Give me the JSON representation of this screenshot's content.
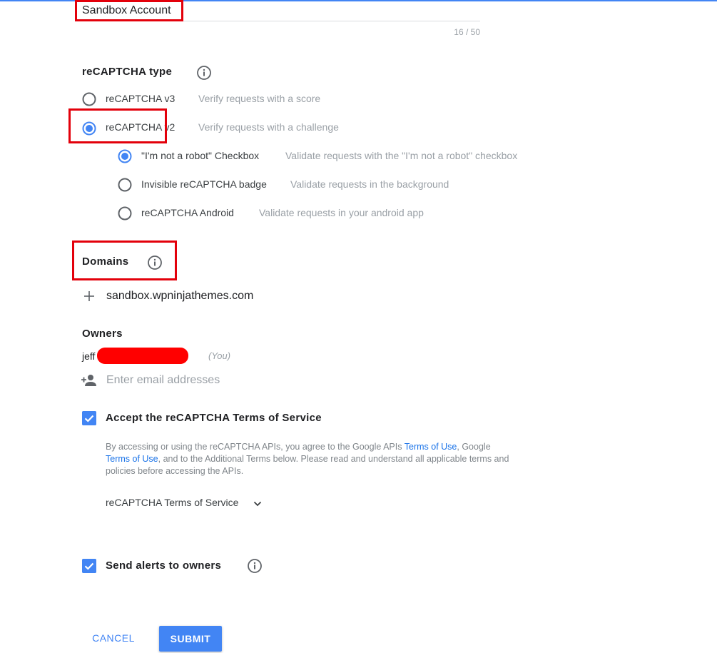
{
  "label_field": {
    "value": "Sandbox Account",
    "counter": "16 / 50"
  },
  "recaptcha_type": {
    "title": "reCAPTCHA type",
    "options": [
      {
        "label": "reCAPTCHA v3",
        "description": "Verify requests with a score",
        "selected": false
      },
      {
        "label": "reCAPTCHA v2",
        "description": "Verify requests with a challenge",
        "selected": true
      }
    ],
    "v2_options": [
      {
        "label": "\"I'm not a robot\" Checkbox",
        "description": "Validate requests with the \"I'm not a robot\" checkbox",
        "selected": true
      },
      {
        "label": "Invisible reCAPTCHA badge",
        "description": "Validate requests in the background",
        "selected": false
      },
      {
        "label": "reCAPTCHA Android",
        "description": "Validate requests in your android app",
        "selected": false
      }
    ]
  },
  "domains": {
    "title": "Domains",
    "items": [
      "sandbox.wpninjathemes.com"
    ]
  },
  "owners": {
    "title": "Owners",
    "items": [
      {
        "name": "jeff",
        "tag": "(You)"
      }
    ],
    "input_placeholder": "Enter email addresses"
  },
  "terms": {
    "checked": true,
    "title": "Accept the reCAPTCHA Terms of Service",
    "text_1": "By accessing or using the reCAPTCHA APIs, you agree to the Google APIs ",
    "link_1": "Terms of Use",
    "text_2": ", Google ",
    "link_2": "Terms of Use",
    "text_3": ", and to the Additional Terms below. Please read and understand all applicable terms and policies before accessing the APIs.",
    "toggle_label": "reCAPTCHA Terms of Service"
  },
  "alerts": {
    "checked": true,
    "title": "Send alerts to owners"
  },
  "buttons": {
    "cancel": "CANCEL",
    "submit": "SUBMIT"
  },
  "colors": {
    "accent": "#4285f4",
    "highlight": "#e3000b",
    "link": "#1a73e8",
    "redaction": "#ff0000"
  }
}
